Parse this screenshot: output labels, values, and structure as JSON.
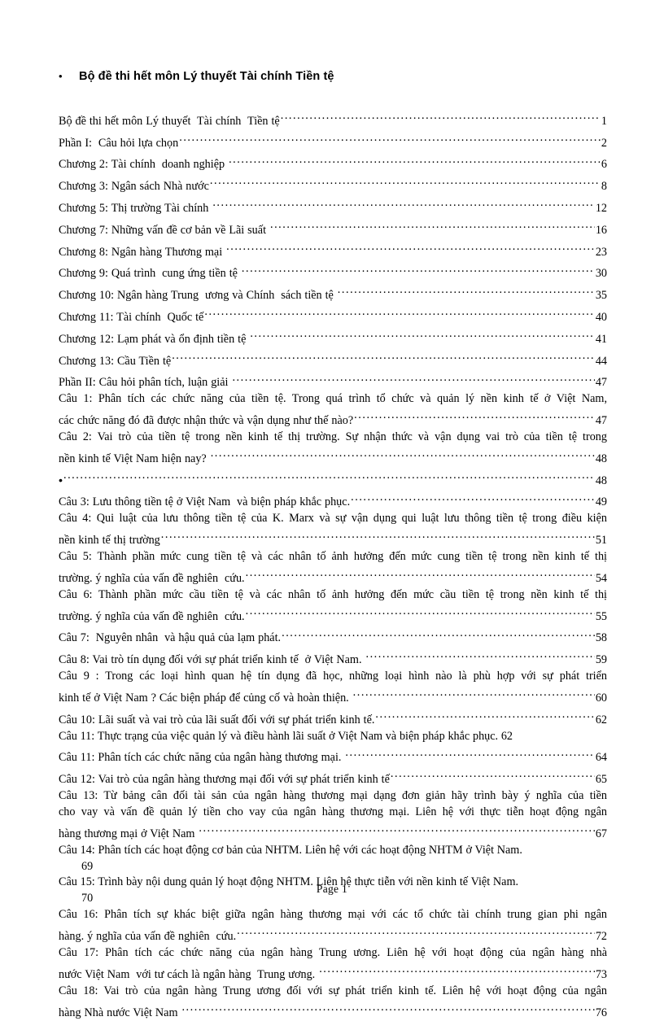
{
  "document": {
    "heading": {
      "bullet": "•",
      "text": "Bộ đề thi hết môn Lý thuyết Tài chính Tiền tệ"
    },
    "footer": {
      "text": "Page  1"
    },
    "toc": {
      "entries": [
        {
          "id": "entry-1",
          "kind": "single",
          "label": "Bộ đề thi hết môn Lý thuyết  Tài chính  Tiền tệ",
          "page": "1"
        },
        {
          "id": "entry-2",
          "kind": "single",
          "label": "Phần I:  Câu hỏi lựa chọn",
          "page": "2"
        },
        {
          "id": "entry-3",
          "kind": "single",
          "label": "Chương 2: Tài chính  doanh nghiệp ",
          "page": "6"
        },
        {
          "id": "entry-4",
          "kind": "single",
          "label": "Chương 3: Ngân sách Nhà nước",
          "page": "8"
        },
        {
          "id": "entry-5",
          "kind": "single",
          "label": "Chương 5: Thị trường Tài chính ",
          "page": "12"
        },
        {
          "id": "entry-6",
          "kind": "single",
          "label": "Chương 7: Những vấn đề cơ bản về Lãi suất ",
          "page": "16"
        },
        {
          "id": "entry-7",
          "kind": "single",
          "label": "Chương 8: Ngân hàng Thương mại ",
          "page": "23"
        },
        {
          "id": "entry-8",
          "kind": "single",
          "label": "Chương 9: Quá trình  cung ứng tiền tệ ",
          "page": "30"
        },
        {
          "id": "entry-9",
          "kind": "single",
          "label": "Chương 10: Ngân hàng Trung  ương và Chính  sách tiền tệ ",
          "page": "35"
        },
        {
          "id": "entry-10",
          "kind": "single",
          "label": "Chương 11: Tài chính  Quốc tế",
          "page": "40"
        },
        {
          "id": "entry-11",
          "kind": "single",
          "label": "Chương 12: Lạm phát và ổn định tiền tệ ",
          "page": "41"
        },
        {
          "id": "entry-12",
          "kind": "single",
          "label": "Chương 13: Cầu Tiền tệ",
          "page": "44"
        },
        {
          "id": "entry-13",
          "kind": "single",
          "label": "Phần II: Câu hỏi phân tích, luận giải ",
          "page": "47"
        },
        {
          "id": "entry-14",
          "kind": "multi",
          "first_lines": "Câu 1: Phân tích các chức năng của tiền tệ. Trong quá trình tổ chức và quản lý nền kinh tế ở Việt Nam,",
          "last_line": "các chức năng đó đã được nhận thức và vận dụng như thế nào?",
          "page": "47"
        },
        {
          "id": "entry-15",
          "kind": "multi",
          "first_lines": "Câu 2: Vai trò của tiền tệ trong nền kinh tế thị trường.  Sự nhận thức và vận dụng vai trò của tiền tệ trong",
          "last_line": "nền kinh tế Việt Nam hiện nay? ",
          "page": "48"
        },
        {
          "id": "entry-16",
          "kind": "bullet",
          "label": "•",
          "page": "48"
        },
        {
          "id": "entry-17",
          "kind": "single",
          "label": "Câu 3: Lưu thông tiền tệ ở Việt Nam  và biện pháp khắc phục.",
          "page": "49"
        },
        {
          "id": "entry-18",
          "kind": "multi",
          "first_lines": "Câu 4: Qui luật của lưu thông tiền tệ của K. Marx và sự vận dụng qui luật lưu thông tiền tệ trong điều kiện",
          "last_line": "nền kinh tế thị trường",
          "page": "51"
        },
        {
          "id": "entry-19",
          "kind": "multi",
          "first_lines": "Câu 5: Thành phần mức cung tiền tệ và các nhân tố ảnh hưởng đến mức cung tiền tệ trong nền kinh tế thị",
          "last_line": "trường. ý nghĩa của vấn đề nghiên  cứu.",
          "page": "54"
        },
        {
          "id": "entry-20",
          "kind": "multi",
          "first_lines": "Câu 6: Thành phần mức cầu tiền tệ và các nhân tố ảnh hưởng đến mức cầu tiền tệ trong nền kinh tế thị",
          "last_line": "trường. ý nghĩa của vấn đề nghiên  cứu.",
          "page": "55"
        },
        {
          "id": "entry-21",
          "kind": "single",
          "label": "Câu 7:  Nguyên nhân  và hậu quả của lạm phát.",
          "page": "58"
        },
        {
          "id": "entry-22",
          "kind": "single",
          "label": "Câu 8: Vai trò tín dụng đối với sự phát triển kinh tế  ở Việt Nam. ",
          "page": "59"
        },
        {
          "id": "entry-23",
          "kind": "multi",
          "first_lines": "Câu 9 :  Trong các loại hình  quan hệ tín dụng đã học, những  loại hình  nào là phù hợp với sự phát triển",
          "last_line": "kinh tế ở Việt Nam ? Các biện pháp để củng cố và hoàn thiện. ",
          "page": "60"
        },
        {
          "id": "entry-24",
          "kind": "single",
          "label": "Câu 10: Lãi suất và vai trò của lãi suất đối với sự phát triển kinh tế.",
          "page": "62"
        },
        {
          "id": "entry-25",
          "kind": "plain",
          "label": "Câu 11: Thực trạng của việc  quản lý và điều hành lãi suất ở Việt Nam và biện pháp khắc phục. 62",
          "page": ""
        },
        {
          "id": "entry-26",
          "kind": "single",
          "label": "Câu 11: Phân tích các chức năng của ngân hàng thương mại. ",
          "page": "64"
        },
        {
          "id": "entry-27",
          "kind": "single",
          "label": "Câu 12: Vai trò của ngân hàng thương mại đối với sự phát triển kinh tế",
          "page": "65"
        },
        {
          "id": "entry-28",
          "kind": "multi3",
          "first_lines": "Câu 13: Từ bảng cân đối tài sản của ngân hàng thương mại dạng đơn giản hãy trình bày ý nghĩa  của tiền",
          "second_lines": "cho vay và vấn đề quản lý  tiền cho vay của ngân hàng thương mại. Liên hệ với thực tiễn hoạt động ngân",
          "last_line": "hàng thương mại ở Việt Nam ",
          "page": "67"
        },
        {
          "id": "entry-29",
          "kind": "pagebelow",
          "label": "Câu 14: Phân tích các hoạt động cơ bản của NHTM. Liên hệ với các hoạt động NHTM ở Việt Nam.",
          "page": "69"
        },
        {
          "id": "entry-30",
          "kind": "pagebelow",
          "label": "Câu 15: Trình bày nội dung quản lý hoạt động NHTM. Liên hệ thực tiễn với nền kinh tế Việt Nam.",
          "page": "70"
        },
        {
          "id": "entry-31",
          "kind": "multi",
          "first_lines": "Câu 16: Phân tích sự khác biệt giữa ngân hàng thương mại với các tổ chức tài chính  trung gian phi ngân",
          "last_line": "hàng. ý nghĩa của vấn đề nghiên  cứu.",
          "page": "72"
        },
        {
          "id": "entry-32",
          "kind": "multi",
          "first_lines": "Câu 17: Phân tích các chức năng của ngân hàng Trung  ương. Liên hệ với hoạt động của ngân hàng nhà",
          "last_line": "nước Việt Nam  với tư cách là ngân hàng  Trung ương. ",
          "page": "73"
        },
        {
          "id": "entry-33",
          "kind": "multi",
          "first_lines": "Câu 18: Vai trò của ngân hàng Trung  ương đối với sự phát triển kinh tế. Liên hệ với hoạt động của ngân",
          "last_line": "hàng Nhà nước Việt Nam ",
          "page": "76"
        }
      ]
    }
  }
}
